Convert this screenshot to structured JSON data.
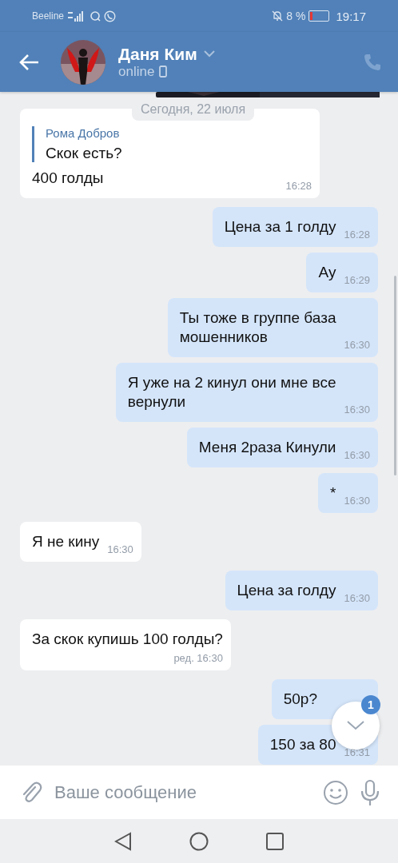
{
  "status_bar": {
    "carrier": "Beeline",
    "battery_text": "8 %",
    "time": "19:17"
  },
  "header": {
    "name": "Даня Ким",
    "status": "online"
  },
  "date_divider": "Сегодня, 22 июля",
  "messages": [
    {
      "kind": "incoming",
      "quote": {
        "author": "Рома Добров",
        "text": "Скок есть?"
      },
      "text": "400 голды",
      "time": "16:28"
    },
    {
      "kind": "outgoing",
      "text": "Цена за 1 голду",
      "time": "16:28"
    },
    {
      "kind": "outgoing",
      "text": "Ау",
      "time": "16:29"
    },
    {
      "kind": "outgoing",
      "text": "Ты тоже в группе база\nмошенников",
      "time": "16:30"
    },
    {
      "kind": "outgoing",
      "text": "Я уже на 2 кинул они мне все\nвернули",
      "time": "16:30"
    },
    {
      "kind": "outgoing",
      "text": "Меня 2раза Кинули",
      "time": "16:30"
    },
    {
      "kind": "outgoing",
      "text": "*",
      "time": "16:30"
    },
    {
      "kind": "incoming",
      "text": "Я не кину",
      "time": "16:30"
    },
    {
      "kind": "outgoing",
      "text": "Цена за голду",
      "time": "16:30"
    },
    {
      "kind": "incoming",
      "text": "За скок купишь 100 голды?",
      "edited": "ред.",
      "time": "16:30"
    },
    {
      "kind": "outgoing",
      "text": "50р?"
    },
    {
      "kind": "outgoing",
      "text": "150 за 80",
      "time": "16:31"
    }
  ],
  "scroll_button": {
    "badge": "1"
  },
  "composer": {
    "placeholder": "Ваше сообщение"
  }
}
